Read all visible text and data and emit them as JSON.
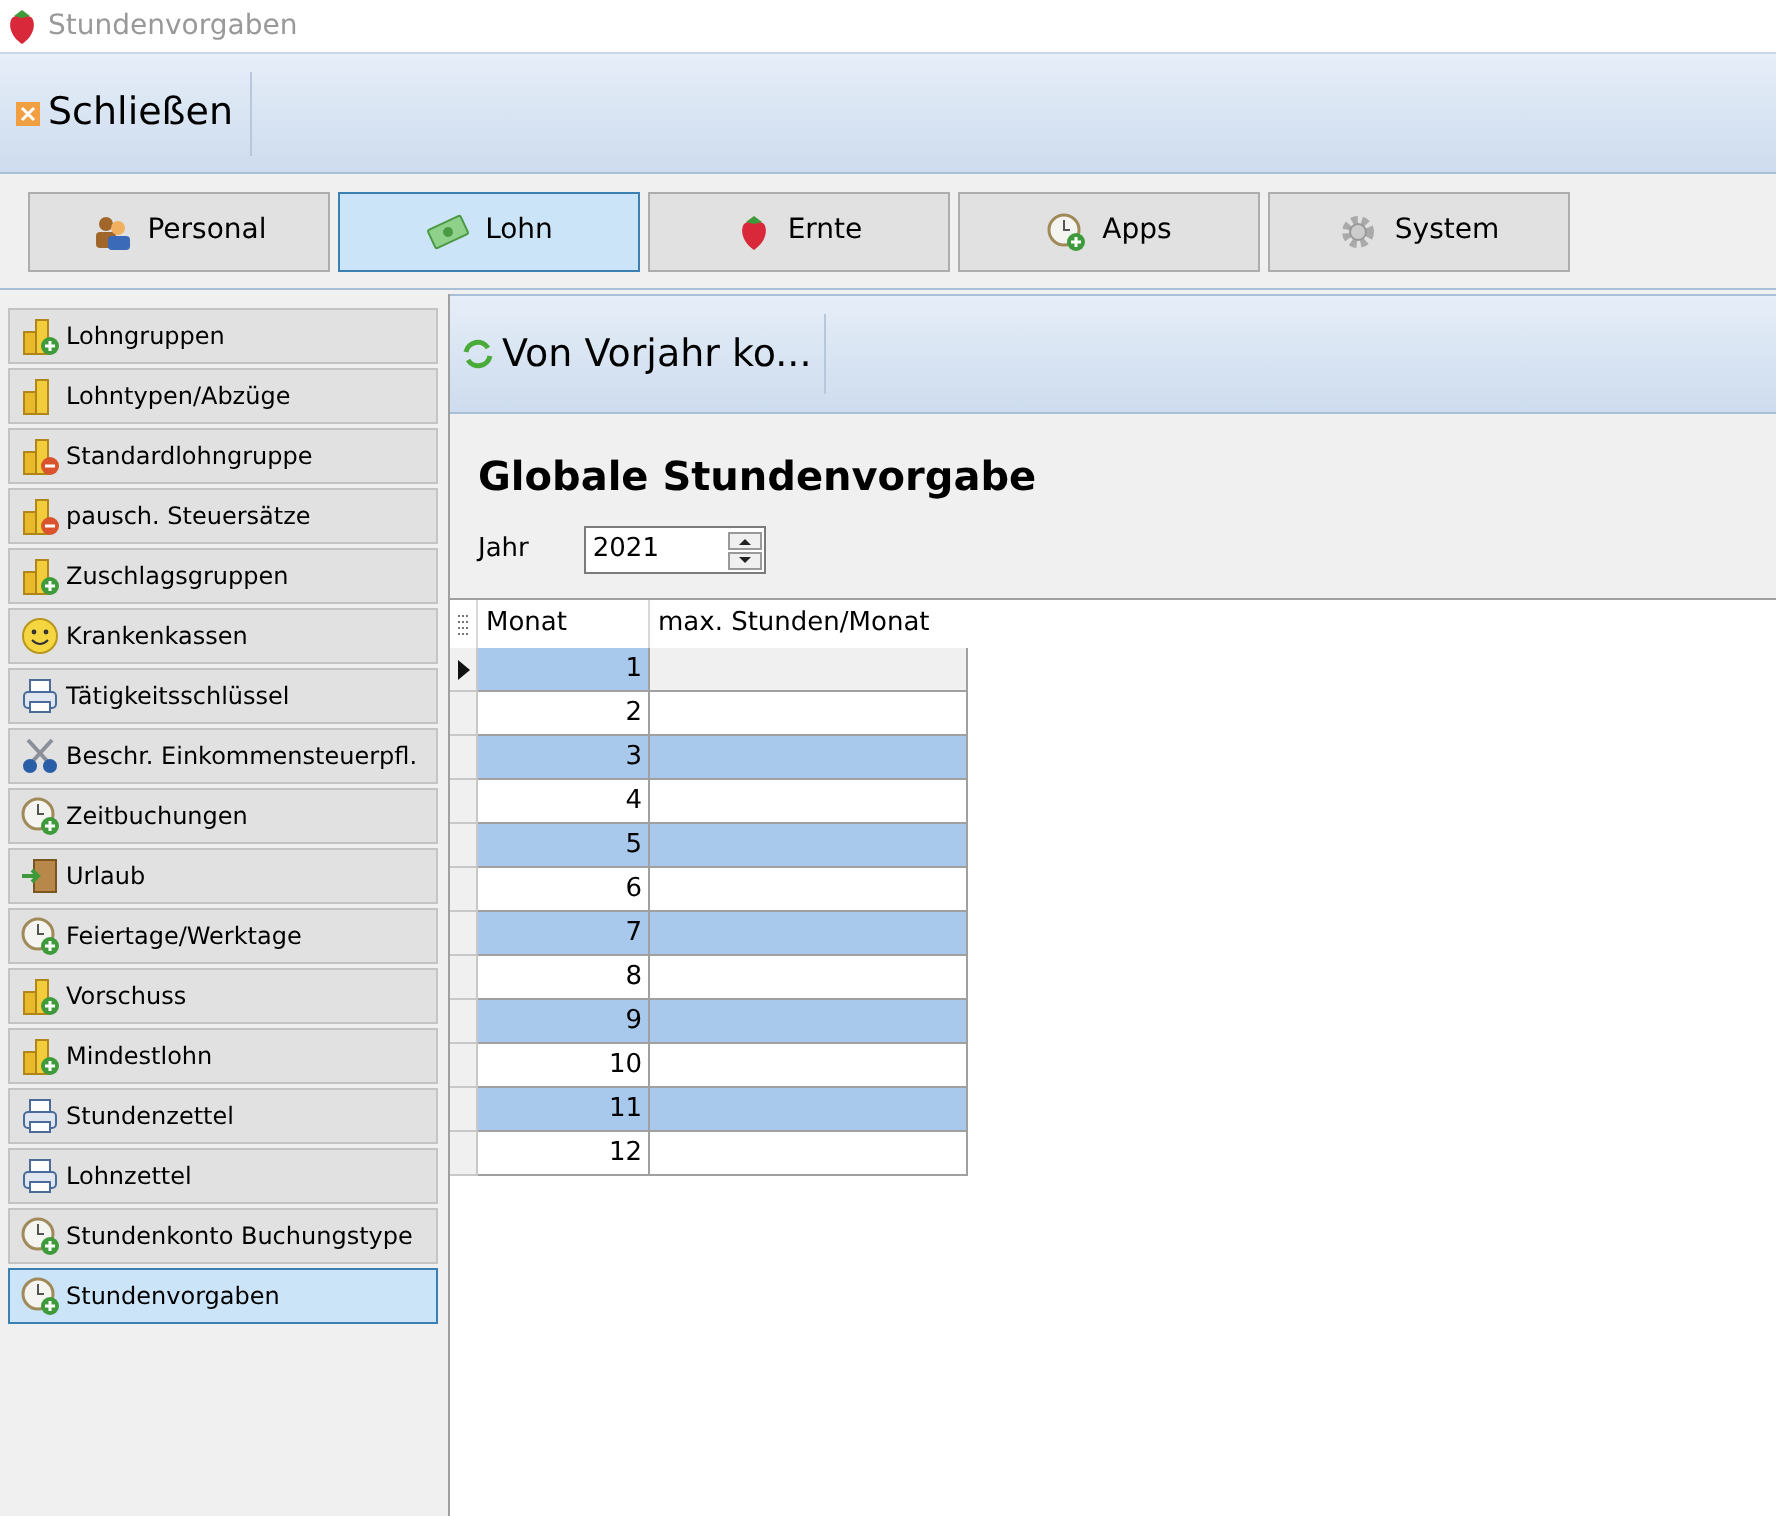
{
  "window": {
    "title": "Stundenvorgaben"
  },
  "toolbar": {
    "close_button": "Schließen"
  },
  "tabs": [
    {
      "label": "Personal",
      "kind": "people",
      "selected": false
    },
    {
      "label": "Lohn",
      "kind": "money",
      "selected": true
    },
    {
      "label": "Ernte",
      "kind": "strawberry",
      "selected": false
    },
    {
      "label": "Apps",
      "kind": "clock",
      "selected": false
    },
    {
      "label": "System",
      "kind": "gear",
      "selected": false
    }
  ],
  "sidebar": {
    "items": [
      {
        "label": "Lohngruppen",
        "kind": "coins-plus",
        "selected": false
      },
      {
        "label": "Lohntypen/Abzüge",
        "kind": "coins",
        "selected": false
      },
      {
        "label": "Standardlohngruppe",
        "kind": "coins-minus",
        "selected": false
      },
      {
        "label": "pausch. Steuersätze",
        "kind": "coins-minus",
        "selected": false
      },
      {
        "label": "Zuschlagsgruppen",
        "kind": "coins-plus",
        "selected": false
      },
      {
        "label": "Krankenkassen",
        "kind": "smiley",
        "selected": false
      },
      {
        "label": "Tätigkeitsschlüssel",
        "kind": "printer",
        "selected": false
      },
      {
        "label": "Beschr. Einkommensteuerpfl.",
        "kind": "scissors",
        "selected": false
      },
      {
        "label": "Zeitbuchungen",
        "kind": "clock",
        "selected": false
      },
      {
        "label": "Urlaub",
        "kind": "door",
        "selected": false
      },
      {
        "label": "Feiertage/Werktage",
        "kind": "clock",
        "selected": false
      },
      {
        "label": "Vorschuss",
        "kind": "coins-plus",
        "selected": false
      },
      {
        "label": "Mindestlohn",
        "kind": "coins-plus",
        "selected": false
      },
      {
        "label": "Stundenzettel",
        "kind": "printer",
        "selected": false
      },
      {
        "label": "Lohnzettel",
        "kind": "printer",
        "selected": false
      },
      {
        "label": "Stundenkonto Buchungstype",
        "kind": "clock",
        "selected": false
      },
      {
        "label": "Stundenvorgaben",
        "kind": "clock",
        "selected": true
      }
    ]
  },
  "panel": {
    "toolbar_button": "Von Vorjahr ko...",
    "heading": "Globale Stundenvorgabe",
    "year_label": "Jahr",
    "year_value": "2021"
  },
  "table": {
    "columns": [
      "Monat",
      "max. Stunden/Monat"
    ],
    "rows": [
      {
        "month": "1",
        "selected": true
      },
      {
        "month": "2",
        "selected": false
      },
      {
        "month": "3",
        "selected": false
      },
      {
        "month": "4",
        "selected": false
      },
      {
        "month": "5",
        "selected": false
      },
      {
        "month": "6",
        "selected": false
      },
      {
        "month": "7",
        "selected": false
      },
      {
        "month": "8",
        "selected": false
      },
      {
        "month": "9",
        "selected": false
      },
      {
        "month": "10",
        "selected": false
      },
      {
        "month": "11",
        "selected": false
      },
      {
        "month": "12",
        "selected": false
      }
    ]
  }
}
